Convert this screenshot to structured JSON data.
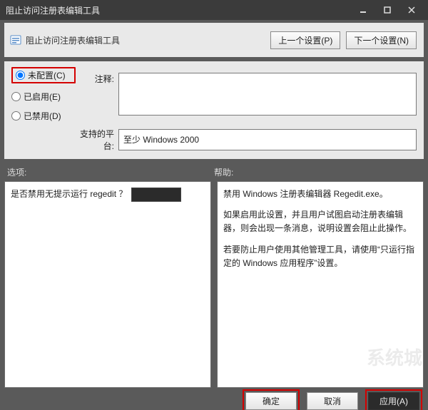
{
  "window": {
    "title": "阻止访问注册表编辑工具"
  },
  "header": {
    "policy_name": "阻止访问注册表编辑工具",
    "prev_button": "上一个设置(P)",
    "next_button": "下一个设置(N)"
  },
  "state": {
    "not_configured": "未配置(C)",
    "enabled": "已启用(E)",
    "disabled": "已禁用(D)",
    "selected": "not_configured"
  },
  "comment": {
    "label": "注释:",
    "value": ""
  },
  "platform": {
    "label": "支持的平台:",
    "value": "至少 Windows 2000"
  },
  "sections": {
    "options_label": "选项:",
    "help_label": "帮助:"
  },
  "options": {
    "question": "是否禁用无提示运行 regedit ？"
  },
  "help": {
    "p1": "禁用 Windows 注册表编辑器 Regedit.exe。",
    "p2": "如果启用此设置，并且用户试图启动注册表编辑器，则会出现一条消息，说明设置会阻止此操作。",
    "p3": "若要防止用户使用其他管理工具，请使用“只运行指定的 Windows 应用程序”设置。"
  },
  "footer": {
    "ok": "确定",
    "cancel": "取消",
    "apply": "应用(A)"
  },
  "watermark": "系统城"
}
